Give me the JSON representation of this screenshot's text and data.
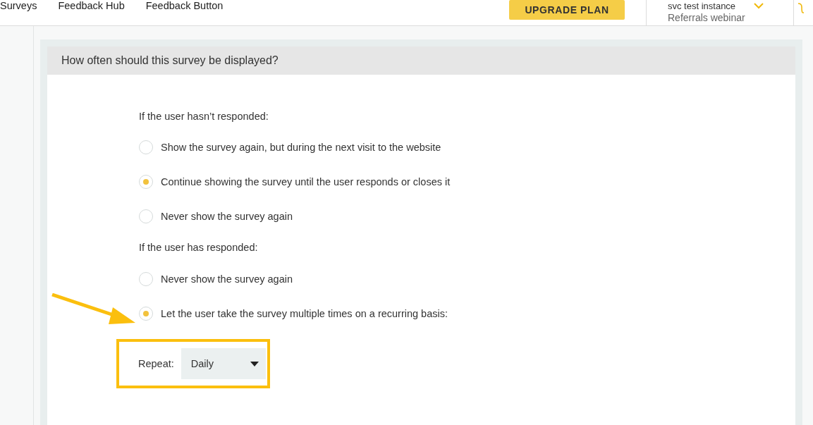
{
  "nav": [
    {
      "label": "Surveys"
    },
    {
      "label": "Feedback Hub"
    },
    {
      "label": "Feedback Button"
    }
  ],
  "upgrade_button": "UPGRADE PLAN",
  "instance": {
    "name": "svc test instance",
    "subtitle": "Referrals webinar"
  },
  "panel": {
    "title": "How often should this survey be displayed?",
    "groups": [
      {
        "heading": "If the user hasn’t responded:",
        "options": [
          {
            "label": "Show the survey again, but during the next visit to the website",
            "selected": false
          },
          {
            "label": "Continue showing the survey until the user responds or closes it",
            "selected": true
          },
          {
            "label": "Never show the survey again",
            "selected": false
          }
        ]
      },
      {
        "heading": "If the user has responded:",
        "options": [
          {
            "label": "Never show the survey again",
            "selected": false
          },
          {
            "label": "Let the user take the survey multiple times on a recurring basis:",
            "selected": true
          }
        ]
      }
    ],
    "repeat": {
      "label": "Repeat:",
      "value": "Daily"
    }
  }
}
